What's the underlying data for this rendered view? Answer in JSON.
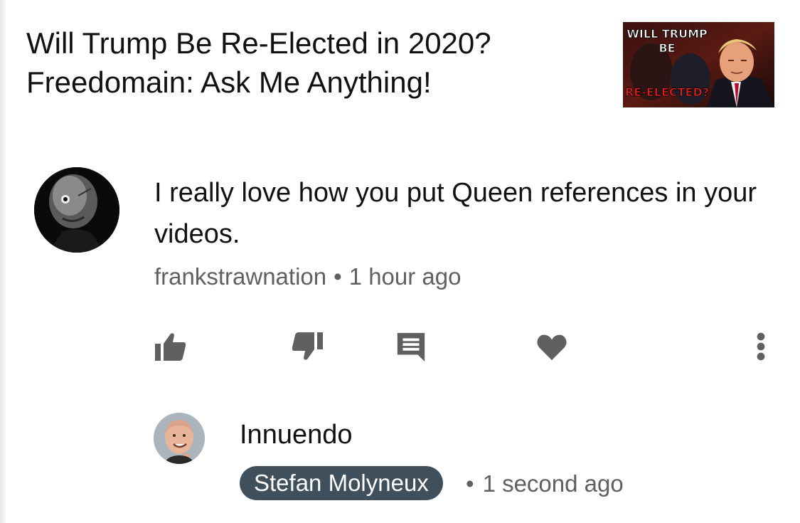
{
  "video": {
    "title_line1": "Will Trump Be Re-Elected in 2020?",
    "title_line2": "Freedomain: Ask Me Anything!",
    "thumbnail_text": [
      "WILL TRUMP",
      "BE",
      "RE-ELECTED?"
    ]
  },
  "comment": {
    "text": "I really love how you put Queen references in your videos.",
    "author": "frankstrawnation",
    "separator": "•",
    "time": "1 hour ago"
  },
  "actions": {
    "like_icon": "thumbs-up-icon",
    "dislike_icon": "thumbs-down-icon",
    "reply_icon": "reply-comment-icon",
    "heart_icon": "heart-icon",
    "more_icon": "more-vertical-icon"
  },
  "reply": {
    "text": "Innuendo",
    "author": "Stefan Molyneux",
    "separator": "•",
    "time": "1 second ago"
  },
  "colors": {
    "text_primary": "#111111",
    "text_secondary": "#606060",
    "icon": "#606060",
    "author_badge": "#3f4f5c"
  }
}
